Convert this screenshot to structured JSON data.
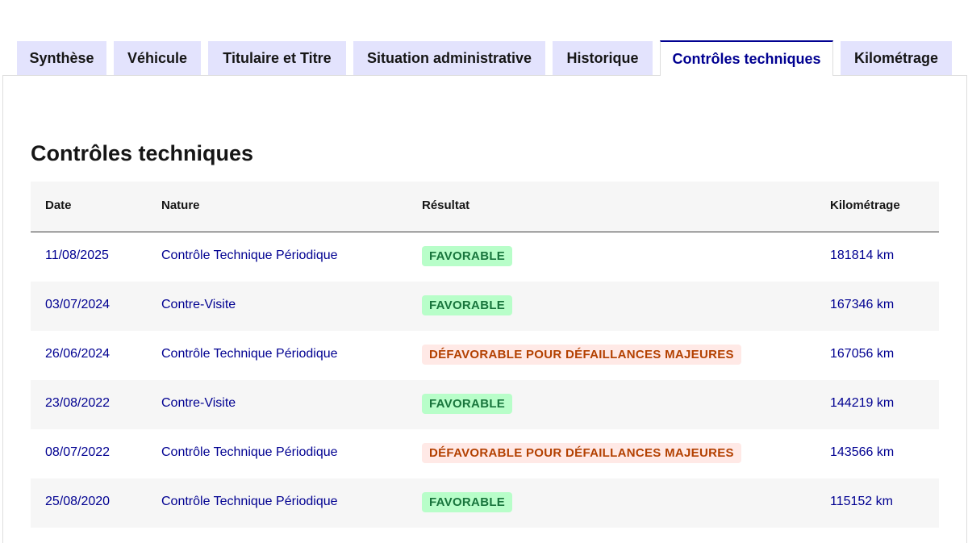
{
  "tabs": [
    {
      "label": "Synthèse"
    },
    {
      "label": "Véhicule"
    },
    {
      "label": "Titulaire et Titre"
    },
    {
      "label": "Situation administrative"
    },
    {
      "label": "Historique"
    },
    {
      "label": "Contrôles techniques",
      "active": true
    },
    {
      "label": "Kilométrage"
    }
  ],
  "section": {
    "title": "Contrôles techniques"
  },
  "table": {
    "headers": {
      "date": "Date",
      "nature": "Nature",
      "result": "Résultat",
      "km": "Kilométrage"
    },
    "rows": [
      {
        "date": "11/08/2025",
        "nature": "Contrôle Technique Périodique",
        "result": "FAVORABLE",
        "status": "success",
        "km": "181814 km"
      },
      {
        "date": "03/07/2024",
        "nature": "Contre-Visite",
        "result": "FAVORABLE",
        "status": "success",
        "km": "167346 km"
      },
      {
        "date": "26/06/2024",
        "nature": "Contrôle Technique Périodique",
        "result": "DÉFAVORABLE POUR DÉFAILLANCES MAJEURES",
        "status": "error",
        "km": "167056 km"
      },
      {
        "date": "23/08/2022",
        "nature": "Contre-Visite",
        "result": "FAVORABLE",
        "status": "success",
        "km": "144219 km"
      },
      {
        "date": "08/07/2022",
        "nature": "Contrôle Technique Périodique",
        "result": "DÉFAVORABLE POUR DÉFAILLANCES MAJEURES",
        "status": "error",
        "km": "143566 km"
      },
      {
        "date": "25/08/2020",
        "nature": "Contrôle Technique Périodique",
        "result": "FAVORABLE",
        "status": "success",
        "km": "115152 km"
      }
    ]
  },
  "colors": {
    "accent": "#000091",
    "tab_bg": "#e3e3fd",
    "success_bg": "#b8fec9",
    "success_text": "#18753c",
    "error_bg": "#ffe9e6",
    "error_text": "#b34000",
    "row_alt_bg": "#f6f6f6"
  }
}
